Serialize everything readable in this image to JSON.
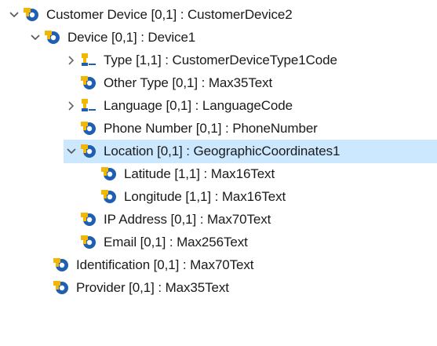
{
  "tree": {
    "nodes": [
      {
        "label": "Customer Device [0,1] : CustomerDevice2",
        "chevron": "expanded",
        "icon": "element-icon",
        "selected": false
      },
      {
        "label": "Device [0,1] : Device1",
        "chevron": "expanded",
        "icon": "element-icon",
        "selected": false
      },
      {
        "label": "Type [1,1] : CustomerDeviceType1Code",
        "chevron": "collapsed",
        "icon": "code-element-icon",
        "selected": false
      },
      {
        "label": "Other Type [0,1] : Max35Text",
        "chevron": "none",
        "icon": "element-icon",
        "selected": false
      },
      {
        "label": "Language [0,1] : LanguageCode",
        "chevron": "collapsed",
        "icon": "code-element-icon",
        "selected": false
      },
      {
        "label": "Phone Number [0,1] : PhoneNumber",
        "chevron": "none",
        "icon": "element-icon",
        "selected": false
      },
      {
        "label": "Location [0,1] : GeographicCoordinates1",
        "chevron": "expanded",
        "icon": "element-icon",
        "selected": true
      },
      {
        "label": "Latitude [1,1] : Max16Text",
        "chevron": "none",
        "icon": "element-icon",
        "selected": false
      },
      {
        "label": "Longitude [1,1] : Max16Text",
        "chevron": "none",
        "icon": "element-icon",
        "selected": false
      },
      {
        "label": "IP Address [0,1] : Max70Text",
        "chevron": "none",
        "icon": "element-icon",
        "selected": false
      },
      {
        "label": "Email [0,1] : Max256Text",
        "chevron": "none",
        "icon": "element-icon",
        "selected": false
      },
      {
        "label": "Identification [0,1] : Max70Text",
        "chevron": "none",
        "icon": "element-icon",
        "selected": false
      },
      {
        "label": "Provider [0,1] : Max35Text",
        "chevron": "none",
        "icon": "element-icon",
        "selected": false
      }
    ]
  },
  "colors": {
    "selection": "#cce8ff",
    "icon_yellow": "#f2b705",
    "icon_blue": "#1e5fb4",
    "chevron": "#555555"
  }
}
